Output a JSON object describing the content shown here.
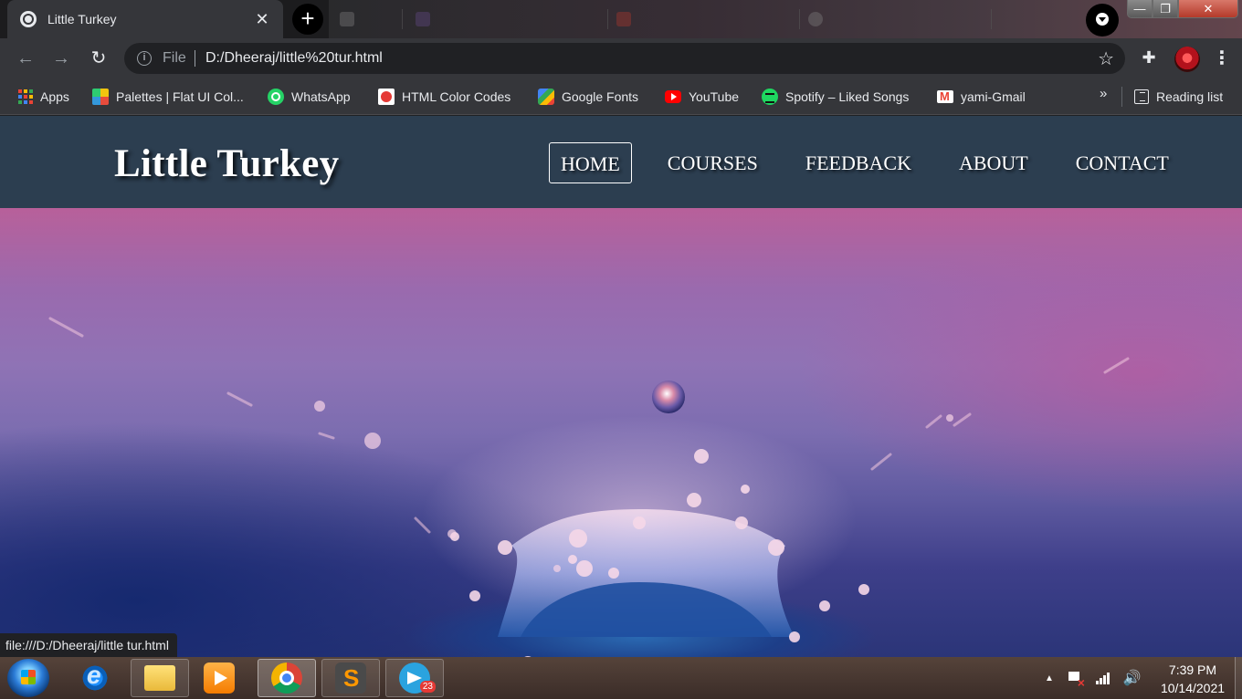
{
  "browser": {
    "active_tab_title": "Little Turkey",
    "close_glyph": "✕",
    "newtab_glyph": "+",
    "omnibox": {
      "scheme": "File",
      "url": "D:/Dheeraj/little%20tur.html"
    },
    "status_url": "file:///D:/Dheeraj/little tur.html",
    "bookmarks": [
      {
        "label": "Apps",
        "icon": "apps-grid-icon"
      },
      {
        "label": "Palettes | Flat UI Col...",
        "icon": "palettes-icon"
      },
      {
        "label": "WhatsApp",
        "icon": "whatsapp-icon"
      },
      {
        "label": "HTML Color Codes",
        "icon": "html-color-codes-icon"
      },
      {
        "label": "Google Fonts",
        "icon": "google-fonts-icon"
      },
      {
        "label": "YouTube",
        "icon": "youtube-icon"
      },
      {
        "label": "Spotify – Liked Songs",
        "icon": "spotify-icon"
      },
      {
        "label": "yami-Gmail",
        "icon": "gmail-icon"
      }
    ],
    "bookmarks_more": "»",
    "reading_list": "Reading list",
    "window_controls": {
      "minimize": "—",
      "maximize": "❐",
      "close": "✕"
    }
  },
  "site": {
    "logo": "Little Turkey",
    "nav": [
      "HOME",
      "COURSES",
      "FEEDBACK",
      "ABOUT",
      "CONTACT"
    ],
    "active_nav": "HOME",
    "header_color": "#2c3e50"
  },
  "taskbar": {
    "apps": [
      "internet-explorer",
      "file-explorer",
      "media-player",
      "chrome",
      "sublime-text",
      "telegram"
    ],
    "telegram_badge": "23",
    "time": "7:39 PM",
    "date": "10/14/2021"
  },
  "colors": {
    "chrome_dark": "#202124",
    "chrome_toolbar": "#35363a",
    "text_light": "#e8eaed"
  }
}
